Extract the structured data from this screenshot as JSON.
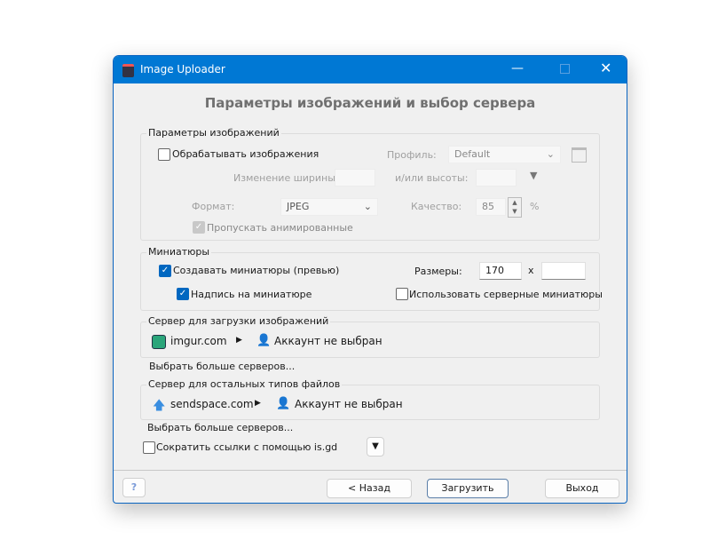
{
  "window": {
    "title": "Image Uploader"
  },
  "header": "Параметры изображений и выбор сервера",
  "image_params": {
    "legend": "Параметры изображений",
    "process_label": "Обрабатывать изображения",
    "process_checked": false,
    "profile_label": "Профиль:",
    "profile_value": "Default",
    "width_label": "Изменение ширины:",
    "height_label": "и/или высоты:",
    "format_label": "Формат:",
    "format_value": "JPEG",
    "quality_label": "Качество:",
    "quality_value": "85",
    "percent": "%",
    "skip_animated_label": "Пропускать анимированные",
    "skip_animated_checked": true
  },
  "thumbnails": {
    "legend": "Миниатюры",
    "create_label": "Создавать миниатюры (превью)",
    "create_checked": true,
    "caption_label": "Надпись на миниатюре",
    "caption_checked": true,
    "size_label": "Размеры:",
    "width_value": "170",
    "x": "x",
    "height_value": "",
    "server_thumbs_label": "Использовать серверные миниатюры",
    "server_thumbs_checked": false
  },
  "image_server": {
    "legend": "Сервер для загрузки изображений",
    "server": "imgur.com",
    "account": "Аккаунт не выбран",
    "more": "Выбрать больше серверов..."
  },
  "file_server": {
    "legend": "Сервер для остальных типов файлов",
    "server": "sendspace.com",
    "account": "Аккаунт не выбран",
    "more": "Выбрать больше серверов..."
  },
  "shorten": {
    "label": "Сократить ссылки с помощью is.gd",
    "checked": false
  },
  "buttons": {
    "back": "< Назад",
    "upload": "Загрузить",
    "exit": "Выход",
    "help": "?"
  },
  "colors": {
    "titlebar": "#0078d4",
    "accent": "#0067c0"
  }
}
